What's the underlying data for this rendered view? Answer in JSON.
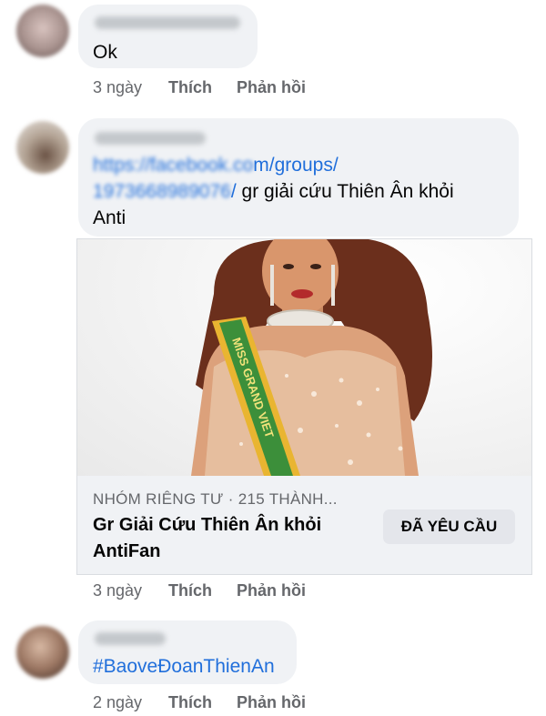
{
  "comments": [
    {
      "text": "Ok",
      "time": "3 ngày",
      "like": "Thích",
      "reply": "Phản hồi"
    },
    {
      "link_blurred_1": "https://facebook.co",
      "link_clear_1": "m/groups/",
      "link_blurred_2": "1973668989076",
      "link_clear_2": "/",
      "text_after_link": " gr giải cứu Thiên Ân khỏi",
      "text_line_3": "Anti",
      "time": "3 ngày",
      "like": "Thích",
      "reply": "Phản hồi",
      "group_card": {
        "meta": "NHÓM RIÊNG TƯ · 215 THÀNH...",
        "title_line_1": "Gr Giải Cứu Thiên Ân khỏi",
        "title_line_2": "AntiFan",
        "button": "ĐÃ YÊU CẦU",
        "sash_text": "MISS GRAND VIET"
      }
    },
    {
      "text": "#BaoveĐoanThienAn",
      "time": "2 ngày",
      "like": "Thích",
      "reply": "Phản hồi"
    }
  ],
  "colors": {
    "bubble": "#f0f2f5",
    "meta_text": "#65676b",
    "link": "#216fdb",
    "button_bg": "#e4e6eb"
  }
}
